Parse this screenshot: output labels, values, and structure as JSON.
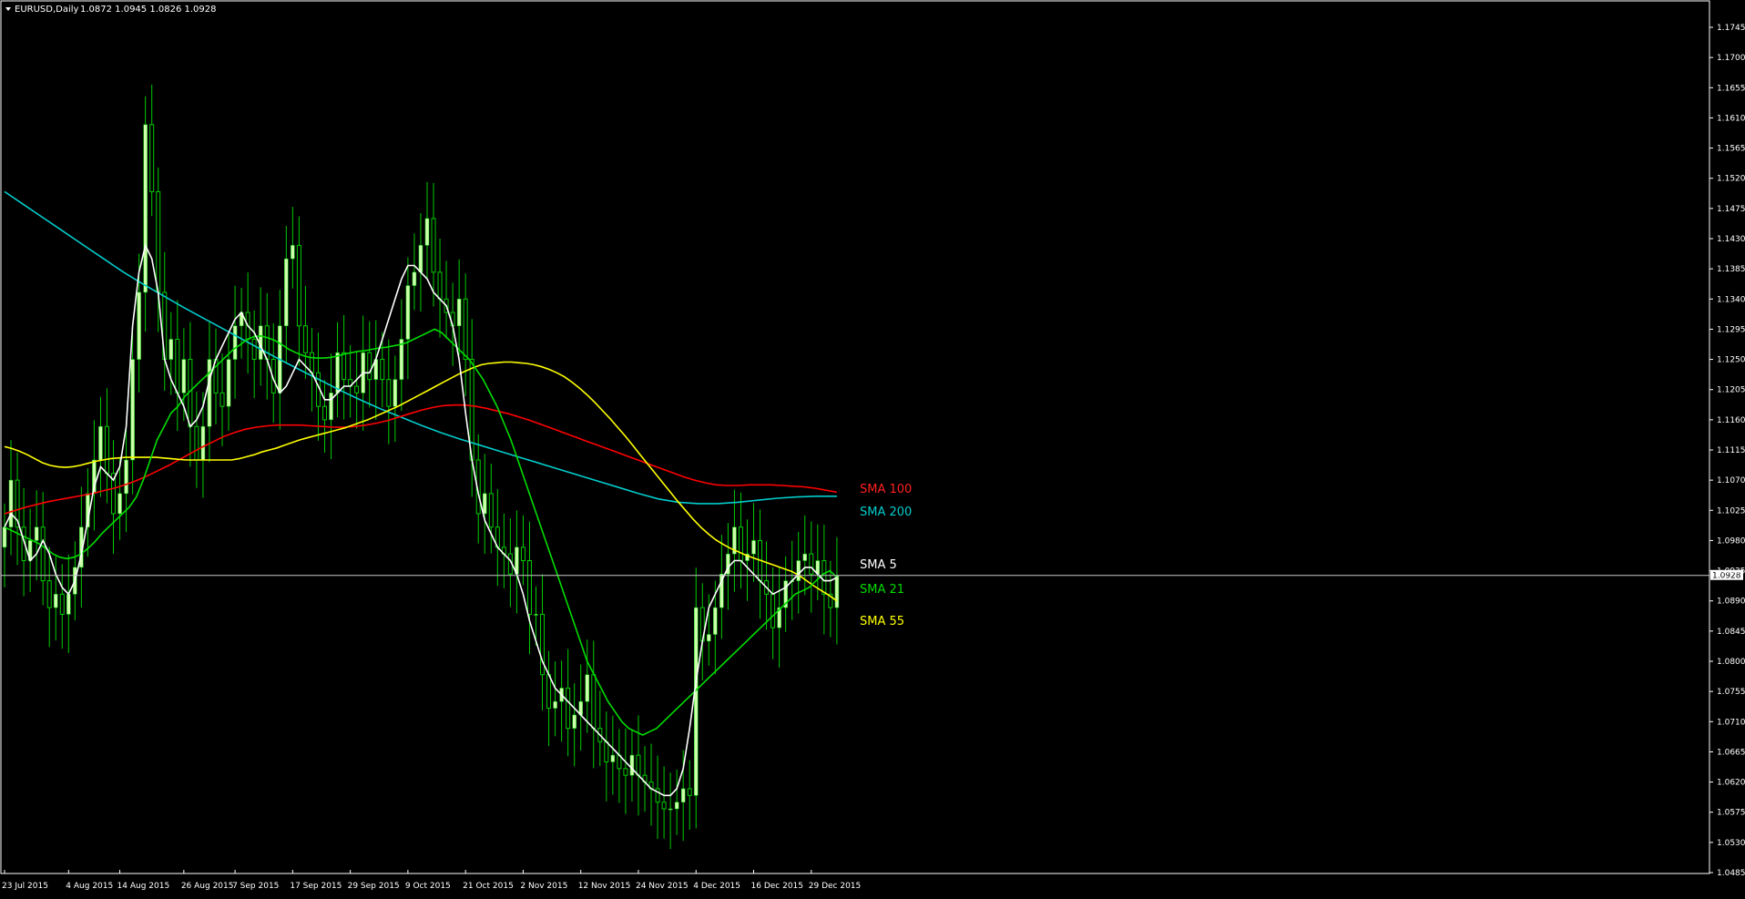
{
  "header": {
    "symbol": "EURUSD,Daily",
    "ohlc": "1.0872 1.0945 1.0826 1.0928"
  },
  "current_price_label": "1.0928",
  "colors": {
    "background": "#000000",
    "frame": "#ffffff",
    "candle_body": "#ccffaa",
    "candle_wick": "#00cc00",
    "sma5": "#ffffff",
    "sma21": "#00dd00",
    "sma55": "#ffff00",
    "sma100": "#ff0000",
    "sma200": "#00cccc"
  },
  "chart_data": {
    "type": "candlestick",
    "price_axis_ticks": [
      "1.1745",
      "1.1700",
      "1.1655",
      "1.1610",
      "1.1565",
      "1.1520",
      "1.1475",
      "1.1430",
      "1.1385",
      "1.1340",
      "1.1295",
      "1.1250",
      "1.1205",
      "1.1160",
      "1.1115",
      "1.1070",
      "1.1025",
      "1.0980",
      "1.0935",
      "1.0890",
      "1.0845",
      "1.0800",
      "1.0755",
      "1.0710",
      "1.0665",
      "1.0620",
      "1.0575",
      "1.0530",
      "1.0485"
    ],
    "ylim": [
      1.0485,
      1.1745
    ],
    "date_axis_labels": [
      {
        "label": "23 Jul 2015",
        "i": 0
      },
      {
        "label": "4 Aug 2015",
        "i": 10
      },
      {
        "label": "14 Aug 2015",
        "i": 18
      },
      {
        "label": "26 Aug 2015",
        "i": 28
      },
      {
        "label": "7 Sep 2015",
        "i": 36
      },
      {
        "label": "17 Sep 2015",
        "i": 45
      },
      {
        "label": "29 Sep 2015",
        "i": 54
      },
      {
        "label": "9 Oct 2015",
        "i": 63
      },
      {
        "label": "21 Oct 2015",
        "i": 72
      },
      {
        "label": "2 Nov 2015",
        "i": 81
      },
      {
        "label": "12 Nov 2015",
        "i": 90
      },
      {
        "label": "24 Nov 2015",
        "i": 99
      },
      {
        "label": "4 Dec 2015",
        "i": 108
      },
      {
        "label": "16 Dec 2015",
        "i": 117
      },
      {
        "label": "29 Dec 2015",
        "i": 126
      }
    ],
    "closes": [
      1.1,
      1.107,
      1.1,
      1.095,
      1.098,
      1.1,
      1.092,
      1.088,
      1.09,
      1.087,
      1.09,
      1.094,
      1.1,
      1.105,
      1.11,
      1.115,
      1.108,
      1.102,
      1.105,
      1.11,
      1.125,
      1.135,
      1.16,
      1.15,
      1.135,
      1.125,
      1.128,
      1.12,
      1.125,
      1.115,
      1.11,
      1.115,
      1.125,
      1.12,
      1.118,
      1.125,
      1.13,
      1.132,
      1.128,
      1.125,
      1.13,
      1.125,
      1.12,
      1.13,
      1.14,
      1.142,
      1.13,
      1.126,
      1.123,
      1.118,
      1.116,
      1.12,
      1.126,
      1.122,
      1.121,
      1.12,
      1.126,
      1.122,
      1.125,
      1.122,
      1.118,
      1.122,
      1.128,
      1.136,
      1.138,
      1.142,
      1.146,
      1.138,
      1.134,
      1.132,
      1.13,
      1.134,
      1.125,
      1.11,
      1.102,
      1.105,
      1.1,
      1.097,
      1.096,
      1.093,
      1.097,
      1.095,
      1.087,
      1.087,
      1.078,
      1.073,
      1.074,
      1.076,
      1.07,
      1.072,
      1.074,
      1.078,
      1.07,
      1.068,
      1.065,
      1.066,
      1.064,
      1.063,
      1.066,
      1.063,
      1.062,
      1.061,
      1.059,
      1.058,
      1.058,
      1.059,
      1.061,
      1.06,
      1.088,
      1.083,
      1.084,
      1.088,
      1.093,
      1.096,
      1.1,
      1.095,
      1.096,
      1.098,
      1.092,
      1.09,
      1.085,
      1.088,
      1.092,
      1.092,
      1.095,
      1.096,
      1.093,
      1.095,
      1.09,
      1.088,
      1.0928
    ],
    "series": [
      {
        "name": "SMA 5",
        "values": [
          1.1,
          1.102,
          1.101,
          1.098,
          1.095,
          1.096,
          1.098,
          1.096,
          1.093,
          1.091,
          1.09,
          1.092,
          1.096,
          1.101,
          1.106,
          1.109,
          1.108,
          1.107,
          1.109,
          1.115,
          1.13,
          1.138,
          1.142,
          1.14,
          1.135,
          1.125,
          1.122,
          1.12,
          1.118,
          1.115,
          1.116,
          1.118,
          1.122,
          1.125,
          1.127,
          1.129,
          1.131,
          1.132,
          1.13,
          1.129,
          1.127,
          1.125,
          1.122,
          1.12,
          1.121,
          1.123,
          1.125,
          1.124,
          1.123,
          1.121,
          1.119,
          1.119,
          1.12,
          1.121,
          1.121,
          1.122,
          1.123,
          1.123,
          1.125,
          1.128,
          1.131,
          1.134,
          1.137,
          1.139,
          1.139,
          1.138,
          1.137,
          1.135,
          1.134,
          1.133,
          1.13,
          1.125,
          1.117,
          1.11,
          1.105,
          1.101,
          1.099,
          1.097,
          1.096,
          1.095,
          1.093,
          1.09,
          1.086,
          1.083,
          1.08,
          1.078,
          1.076,
          1.075,
          1.074,
          1.073,
          1.072,
          1.071,
          1.07,
          1.069,
          1.068,
          1.067,
          1.066,
          1.065,
          1.064,
          1.063,
          1.062,
          1.061,
          1.0605,
          1.06,
          1.06,
          1.061,
          1.064,
          1.07,
          1.077,
          1.083,
          1.088,
          1.09,
          1.092,
          1.094,
          1.095,
          1.095,
          1.094,
          1.093,
          1.092,
          1.091,
          1.09,
          1.0905,
          1.091,
          1.092,
          1.093,
          1.094,
          1.094,
          1.093,
          1.092,
          1.092,
          1.0925
        ]
      },
      {
        "name": "SMA 21",
        "values": [
          1.1,
          1.0995,
          1.099,
          1.0985,
          1.098,
          1.0975,
          1.0968,
          1.096,
          1.0955,
          1.0953,
          1.0955,
          1.096,
          1.0968,
          1.0978,
          1.099,
          1.1,
          1.101,
          1.102,
          1.103,
          1.1045,
          1.107,
          1.11,
          1.113,
          1.115,
          1.117,
          1.118,
          1.1195,
          1.1205,
          1.1215,
          1.1225,
          1.1235,
          1.1245,
          1.1255,
          1.1265,
          1.1272,
          1.128,
          1.1284,
          1.1285,
          1.1282,
          1.1278,
          1.1272,
          1.1265,
          1.126,
          1.1256,
          1.1253,
          1.1252,
          1.1252,
          1.1253,
          1.1255,
          1.1258,
          1.126,
          1.1262,
          1.1263,
          1.1265,
          1.1267,
          1.1268,
          1.127,
          1.1272,
          1.1275,
          1.128,
          1.1285,
          1.129,
          1.1295,
          1.129,
          1.128,
          1.127,
          1.126,
          1.125,
          1.1235,
          1.122,
          1.12,
          1.118,
          1.1155,
          1.113,
          1.11,
          1.107,
          1.104,
          1.101,
          1.098,
          1.095,
          1.092,
          1.089,
          1.086,
          1.083,
          1.08,
          1.078,
          1.076,
          1.074,
          1.0725,
          1.071,
          1.07,
          1.0695,
          1.069,
          1.0695,
          1.07,
          1.071,
          1.072,
          1.073,
          1.074,
          1.075,
          1.076,
          1.077,
          1.078,
          1.079,
          1.08,
          1.081,
          1.082,
          1.083,
          1.084,
          1.085,
          1.086,
          1.087,
          1.088,
          1.089,
          1.09,
          1.0905,
          1.091,
          1.092,
          1.093,
          1.0935,
          1.0925
        ]
      },
      {
        "name": "SMA 55",
        "values": [
          1.112,
          1.1117,
          1.1113,
          1.1108,
          1.1102,
          1.1096,
          1.1092,
          1.109,
          1.1089,
          1.109,
          1.1092,
          1.1095,
          1.1098,
          1.11,
          1.1102,
          1.1103,
          1.1104,
          1.1104,
          1.1104,
          1.1104,
          1.1104,
          1.1103,
          1.1102,
          1.1101,
          1.11,
          1.11,
          1.11,
          1.11,
          1.11,
          1.11,
          1.11,
          1.1102,
          1.1105,
          1.1108,
          1.1112,
          1.1115,
          1.1118,
          1.1122,
          1.1126,
          1.113,
          1.1133,
          1.1136,
          1.1139,
          1.1142,
          1.1145,
          1.1148,
          1.1152,
          1.1156,
          1.116,
          1.1165,
          1.117,
          1.1175,
          1.118,
          1.1186,
          1.1192,
          1.1198,
          1.1204,
          1.121,
          1.1216,
          1.1222,
          1.1228,
          1.1233,
          1.1238,
          1.1242,
          1.1244,
          1.1245,
          1.1246,
          1.1246,
          1.1245,
          1.1244,
          1.1242,
          1.1239,
          1.1235,
          1.123,
          1.1224,
          1.1216,
          1.1207,
          1.1197,
          1.1186,
          1.1174,
          1.1162,
          1.1149,
          1.1136,
          1.1122,
          1.1108,
          1.1094,
          1.108,
          1.1066,
          1.1052,
          1.1038,
          1.1025,
          1.1012,
          1.1,
          1.099,
          1.0981,
          1.0974,
          1.0968,
          1.0963,
          1.0958,
          1.0954,
          1.095,
          1.0946,
          1.0942,
          1.0938,
          1.0934,
          1.0928,
          1.092,
          1.0912,
          1.0905,
          1.0898,
          1.089
        ]
      },
      {
        "name": "SMA 100",
        "values": [
          1.102,
          1.1025,
          1.103,
          1.1034,
          1.1038,
          1.1041,
          1.1044,
          1.1047,
          1.105,
          1.1054,
          1.1058,
          1.1063,
          1.1069,
          1.1076,
          1.1084,
          1.1092,
          1.1101,
          1.111,
          1.1119,
          1.1127,
          1.1135,
          1.1141,
          1.1146,
          1.1149,
          1.1151,
          1.1152,
          1.1152,
          1.1152,
          1.1151,
          1.115,
          1.1149,
          1.1149,
          1.115,
          1.1152,
          1.1155,
          1.1159,
          1.1164,
          1.1169,
          1.1174,
          1.1178,
          1.1181,
          1.1182,
          1.1182,
          1.118,
          1.1177,
          1.1173,
          1.1169,
          1.1164,
          1.1159,
          1.1153,
          1.1147,
          1.1141,
          1.1135,
          1.1129,
          1.1123,
          1.1117,
          1.1111,
          1.1105,
          1.1099,
          1.1093,
          1.1087,
          1.1081,
          1.1075,
          1.107,
          1.1066,
          1.1063,
          1.1062,
          1.1062,
          1.1063,
          1.1063,
          1.1063,
          1.1062,
          1.1061,
          1.106,
          1.1058,
          1.1055,
          1.1052
        ]
      },
      {
        "name": "SMA 200",
        "values": [
          1.15,
          1.148,
          1.146,
          1.144,
          1.142,
          1.14,
          1.138,
          1.1362,
          1.1345,
          1.1328,
          1.1312,
          1.1296,
          1.128,
          1.1264,
          1.1248,
          1.1233,
          1.1218,
          1.1203,
          1.1189,
          1.1176,
          1.1164,
          1.1152,
          1.1141,
          1.1131,
          1.1122,
          1.1113,
          1.1104,
          1.1095,
          1.1086,
          1.1077,
          1.1068,
          1.1059,
          1.105,
          1.1042,
          1.1037,
          1.1035,
          1.1035,
          1.1037,
          1.104,
          1.1043,
          1.1045,
          1.1046,
          1.1046
        ]
      }
    ],
    "series_labels": [
      "SMA 100",
      "SMA 200",
      "SMA 5",
      "SMA 21",
      "SMA 55"
    ]
  }
}
